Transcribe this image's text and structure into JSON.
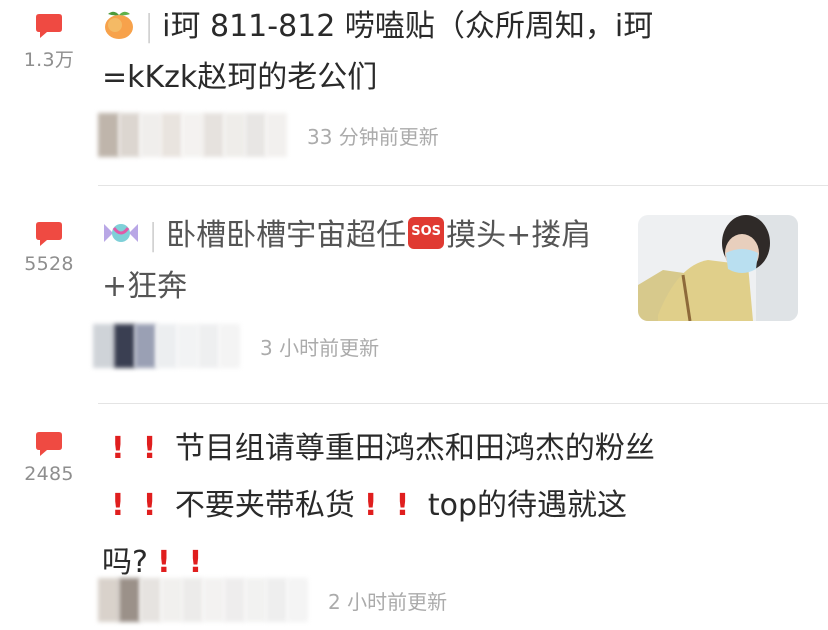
{
  "posts": [
    {
      "comment_count": "1.3万",
      "leading_icon": "peach-emoji",
      "title": "i珂 811-812 唠嗑贴（众所周知，i珂=kKzk赵珂的老公们",
      "timestamp": "33 分钟前更新"
    },
    {
      "comment_count": "5528",
      "leading_icon": "candy-emoji",
      "title_part1": "卧槽卧槽宇宙超任",
      "badge": "SOS",
      "title_part2": "摸头+搂肩+狂奔",
      "timestamp": "3 小时前更新",
      "thumbnail": "photo-person-wearing-mask"
    },
    {
      "comment_count": "2485",
      "title_segments": [
        "节目组请尊重田鸿杰和田鸿杰的粉丝",
        "不要夹带私货",
        "top的待遇就这",
        "吗?"
      ],
      "emphasis_icon": "red-exclamation-icon",
      "timestamp": "2 小时前更新"
    }
  ],
  "colors": {
    "comment_icon": "#ef4a42",
    "exclamation": "#e01e1e",
    "sos_badge": "#e03a32",
    "meta_text": "#ababab",
    "count_text": "#8e8e8e"
  }
}
